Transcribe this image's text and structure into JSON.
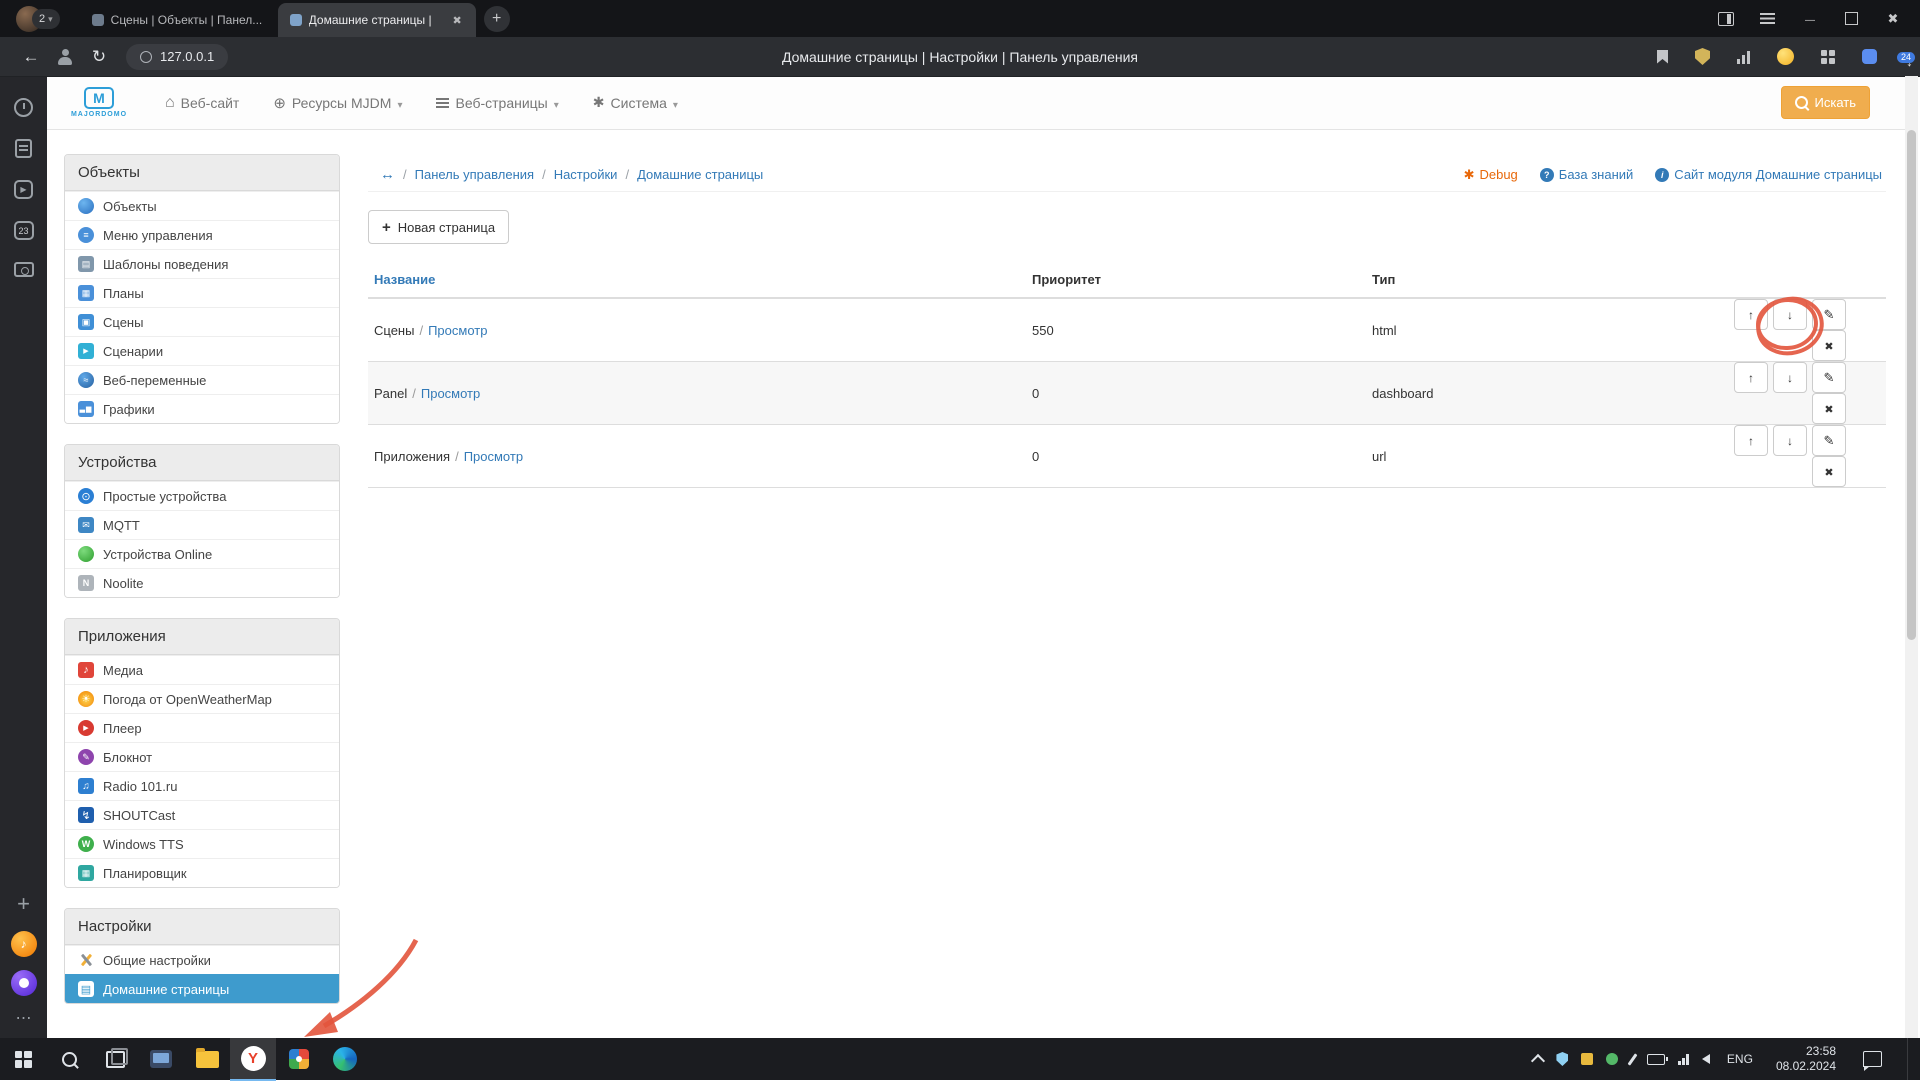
{
  "browser": {
    "profile_badge": "2",
    "tabs": {
      "tab1": "Сцены | Объекты | Панел...",
      "tab2": "Домашние страницы |"
    },
    "address": "127.0.0.1",
    "window_title": "Домашние страницы | Настройки | Панель управления",
    "downloads_badge": "24"
  },
  "strip": {
    "badge23": "23"
  },
  "nav": {
    "logo_letter": "M",
    "logo_text": "MAJORDOMO",
    "website": "Веб-сайт",
    "resources": "Ресурсы MJDM",
    "webpages": "Веб-страницы",
    "system": "Система",
    "search": "Искать"
  },
  "sidebar": {
    "sections": [
      {
        "title": "Объекты",
        "items": [
          {
            "icon": "globe",
            "label": "Объекты"
          },
          {
            "icon": "menu",
            "label": "Меню управления"
          },
          {
            "icon": "template",
            "label": "Шаблоны поведения"
          },
          {
            "icon": "plans",
            "label": "Планы"
          },
          {
            "icon": "scenes",
            "label": "Сцены"
          },
          {
            "icon": "scenarios",
            "label": "Сценарии"
          },
          {
            "icon": "webvars",
            "label": "Веб-переменные"
          },
          {
            "icon": "charts",
            "label": "Графики"
          }
        ]
      },
      {
        "title": "Устройства",
        "items": [
          {
            "icon": "power",
            "label": "Простые устройства"
          },
          {
            "icon": "mqtt",
            "label": "MQTT"
          },
          {
            "icon": "online",
            "label": "Устройства Online"
          },
          {
            "icon": "noolite",
            "label": "Noolite"
          }
        ]
      },
      {
        "title": "Приложения",
        "items": [
          {
            "icon": "media",
            "label": "Медиа"
          },
          {
            "icon": "weather",
            "label": "Погода от OpenWeatherMap"
          },
          {
            "icon": "player",
            "label": "Плеер"
          },
          {
            "icon": "notepad",
            "label": "Блокнот"
          },
          {
            "icon": "radio",
            "label": "Radio 101.ru"
          },
          {
            "icon": "shoutcast",
            "label": "SHOUTCast"
          },
          {
            "icon": "wintts",
            "label": "Windows TTS"
          },
          {
            "icon": "scheduler",
            "label": "Планировщик"
          }
        ]
      },
      {
        "title": "Настройки",
        "items": [
          {
            "icon": "tools",
            "label": "Общие настройки"
          },
          {
            "icon": "homepage",
            "label": "Домашние страницы"
          }
        ]
      }
    ]
  },
  "crumbs": {
    "sep": "/",
    "c1": "Панель управления",
    "c2": "Настройки",
    "c3": "Домашние страницы",
    "debug": "Debug",
    "kb": "База знаний",
    "module": "Сайт модуля Домашние страницы"
  },
  "main": {
    "new_page": "Новая страница",
    "table": {
      "sep": "/",
      "h_name": "Название",
      "h_priority": "Приоритет",
      "h_type": "Тип",
      "rows": [
        {
          "name": "Сцены",
          "view": "Просмотр",
          "priority": "550",
          "type": "html"
        },
        {
          "name": "Panel",
          "view": "Просмотр",
          "priority": "0",
          "type": "dashboard"
        },
        {
          "name": "Приложения",
          "view": "Просмотр",
          "priority": "0",
          "type": "url"
        }
      ]
    }
  },
  "taskbar": {
    "lang": "ENG",
    "time": "23:58",
    "date": "08.02.2024"
  },
  "colors": {
    "link_blue": "#337ab7",
    "selected_blue": "#3e9bcd",
    "search_orange": "#f0ad4e",
    "debug_orange": "#e8680a",
    "annotation_red": "#e2543c"
  }
}
